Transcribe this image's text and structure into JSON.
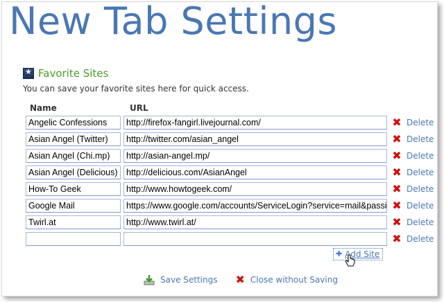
{
  "page": {
    "title": "New Tab Settings"
  },
  "favorites": {
    "title": "Favorite Sites",
    "description": "You can save your favorite sites here for quick access.",
    "column_name": "Name",
    "column_url": "URL",
    "delete_label": "Delete",
    "rows": [
      {
        "name": "Angelic Confessions",
        "url": "http://firefox-fangirl.livejournal.com/"
      },
      {
        "name": "Asian Angel (Twitter)",
        "url": "http://twitter.com/asian_angel"
      },
      {
        "name": "Asian Angel (Chi.mp)",
        "url": "http://asian-angel.mp/"
      },
      {
        "name": "Asian Angel (Delicious)",
        "url": "http://delicious.com/AsianAngel"
      },
      {
        "name": "How-To Geek",
        "url": "http://www.howtogeek.com/"
      },
      {
        "name": "Google Mail",
        "url": "https://www.google.com/accounts/ServiceLogin?service=mail&passi"
      },
      {
        "name": "Twirl.at",
        "url": "http://www.twirl.at/"
      },
      {
        "name": "",
        "url": ""
      }
    ],
    "add_site_label": "Add Site"
  },
  "footer": {
    "save_label": "Save Settings",
    "close_label": "Close without Saving"
  },
  "colors": {
    "title_blue": "#4a77b4",
    "section_green": "#4c9a2a",
    "delete_red": "#cc1111"
  },
  "icons": {
    "section": "favorites-star-icon",
    "delete": "delete-x-icon",
    "add": "plus-icon",
    "save": "save-download-icon",
    "close": "close-x-icon",
    "cursor": "hand-cursor-icon"
  }
}
